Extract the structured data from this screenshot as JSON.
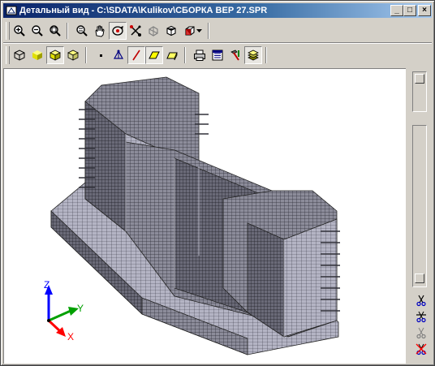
{
  "window": {
    "title": "Детальный вид - C:\\SDATA\\Kulikov\\СБОРКА ВЕР 27.SPR",
    "minimize": "_",
    "maximize": "□",
    "close": "×"
  },
  "toolbar1": {
    "tools": [
      "zoom-in",
      "zoom-out",
      "zoom-window",
      "zoom-all",
      "pan",
      "rotate",
      "select-elements",
      "hide",
      "projection",
      "view-direction-dropdown"
    ]
  },
  "toolbar2": {
    "tools": [
      "wireframe-view",
      "solid-view",
      "shaded-view",
      "hidden-line-view",
      "nodes",
      "supports",
      "bars",
      "plates",
      "solids",
      "print",
      "export",
      "tools",
      "layers"
    ]
  },
  "axes": {
    "z": "Z",
    "y": "Y",
    "x": "X"
  },
  "colors": {
    "axis_z": "#0000ff",
    "axis_y": "#00a000",
    "axis_x": "#ff0000",
    "model_mesh": "#5a5a66",
    "titlebar": "#0a246a"
  }
}
